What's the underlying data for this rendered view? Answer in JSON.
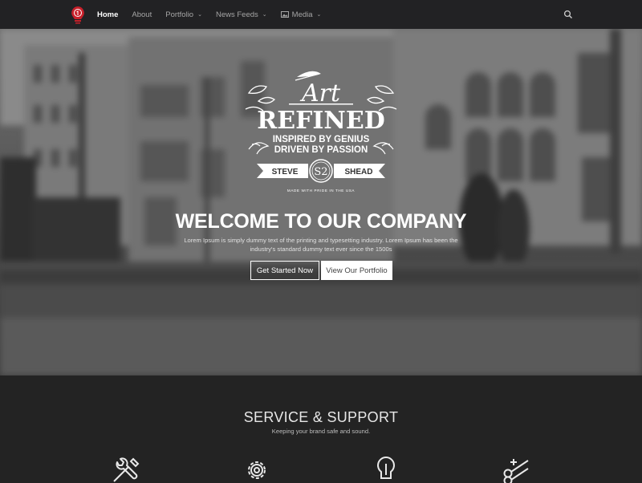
{
  "nav": {
    "items": [
      {
        "label": "Home",
        "active": true,
        "has_caret": false
      },
      {
        "label": "About",
        "active": false,
        "has_caret": false
      },
      {
        "label": "Portfolio",
        "active": false,
        "has_caret": true
      },
      {
        "label": "News Feeds",
        "active": false,
        "has_caret": true
      },
      {
        "label": "Media",
        "active": false,
        "has_caret": true,
        "icon": "image-icon"
      }
    ],
    "search_icon": "search-icon"
  },
  "hero": {
    "badge": {
      "art": "Art",
      "refined": "REFINED",
      "line1": "INSPIRED BY GENIUS",
      "line2": "DRIVEN BY PASSION",
      "left": "STEVE",
      "mono": "S2",
      "right": "SHEAD",
      "tiny": "MADE WITH PRIDE IN THE USA"
    },
    "title": "WELCOME TO OUR COMPANY",
    "text": "Lorem Ipsum is simply dummy text of the printing and typesetting industry. Lorem Ipsum has been the industry's standard dummy text ever since the 1500s",
    "buttons": {
      "primary": "Get Started Now",
      "secondary": "View Our Portfolio"
    }
  },
  "services": {
    "title": "SERVICE & SUPPORT",
    "subtitle": "Keeping your brand safe and sound.",
    "icons": [
      "tools-icon",
      "gear-icon",
      "lightbulb-icon",
      "scissors-icon"
    ]
  },
  "colors": {
    "nav_bg": "#222224",
    "page_bg": "#232323",
    "logo_red": "#c8202a"
  }
}
